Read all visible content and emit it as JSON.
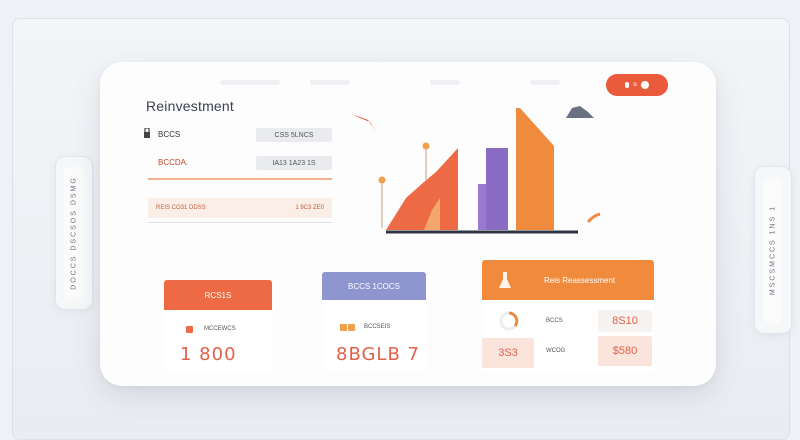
{
  "title": "Reinvestment",
  "toggle_label": "o",
  "form": {
    "row1_label": "BCCS",
    "row1_value": "CSS 5LNCS",
    "row2_label": "BCCDA.",
    "row2_value": "IA13 1A23 1S",
    "band_left": "REIS CO31 DDSS",
    "band_right": "1 9C3 ZE0"
  },
  "stat_cards": [
    {
      "header": "RCS1S",
      "item_label": "MCCEWCS",
      "value": "1 800"
    },
    {
      "header": "BCCS 1COCS",
      "item_label": "BCCSEIS",
      "value": "8BGLB 7"
    }
  ],
  "table": {
    "header": "Reis Reassessment",
    "rows": [
      {
        "label": "BCCS",
        "value": "8S10"
      },
      {
        "label": "WCOG",
        "value": "$580"
      }
    ],
    "footer_left": "3S3"
  },
  "left_widget_text": "DOCCS DSCSOS DSMG",
  "right_widget_text": "MSCSMCCS 1NS 1",
  "colors": {
    "accent_orange": "#f08a3c",
    "accent_red": "#ea5b3b",
    "accent_purple": "#8b6cc4",
    "periwinkle": "#8e95cf"
  }
}
